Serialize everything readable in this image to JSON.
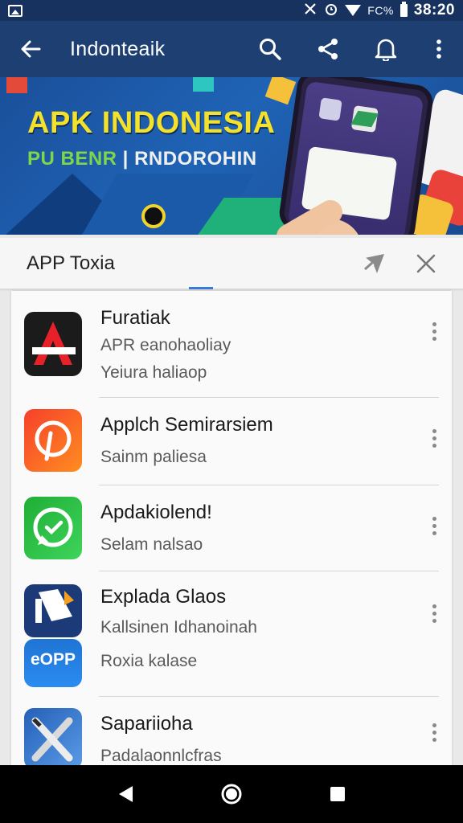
{
  "status_bar": {
    "indicators": "FC%",
    "time": "38:20",
    "icons": [
      "gallery-icon",
      "vibrate-icon",
      "alarm-icon",
      "wifi-icon",
      "battery-icon"
    ]
  },
  "app_bar": {
    "title": "Indonteaik",
    "icons": [
      "back-arrow-icon",
      "search-icon",
      "share-icon",
      "bell-icon",
      "more-vert-icon"
    ]
  },
  "banner": {
    "headline": "APK INDONESIA",
    "sub_part1": "PU BENR",
    "sub_sep": " | ",
    "sub_part2": "RNDOROHIN"
  },
  "panel": {
    "title": "APP Toxia",
    "icons": [
      "shuffle-icon",
      "close-icon"
    ]
  },
  "apps": [
    {
      "name": "Furatiak",
      "line2": "APR eanohaoliay",
      "line3": "Yeiura haliaop",
      "icon": "red-a-app-icon",
      "icon_colors": [
        "#1b1b1b",
        "#e8202a"
      ]
    },
    {
      "name": "Applch Semirarsiem",
      "line2": "Sainm paliesa",
      "line3": "",
      "icon": "orange-p-app-icon",
      "icon_colors": [
        "#f44b2c",
        "#ff8a1f"
      ]
    },
    {
      "name": "Apdakiolend!",
      "line2": "Selam nalsao",
      "line3": "",
      "icon": "green-chat-app-icon",
      "icon_colors": [
        "#22b33a",
        "#3ed45a"
      ]
    },
    {
      "name": "Explada Glaos",
      "line2": "Kallsinen Idhanoinah",
      "line3": "Roxia kalase",
      "icon": "blue-flag-app-icon",
      "icon_colors": [
        "#1c3a78",
        "#1f74d4"
      ],
      "icon2_label": "eOPP"
    },
    {
      "name": "Sapariioha",
      "line2": "Padalaonnlcfras",
      "line3": "",
      "icon": "tools-app-icon",
      "icon_colors": [
        "#2460b8",
        "#5a9be6"
      ]
    }
  ],
  "nav_bar": {
    "icons": [
      "back-triangle-icon",
      "home-circle-icon",
      "recents-square-icon"
    ]
  }
}
